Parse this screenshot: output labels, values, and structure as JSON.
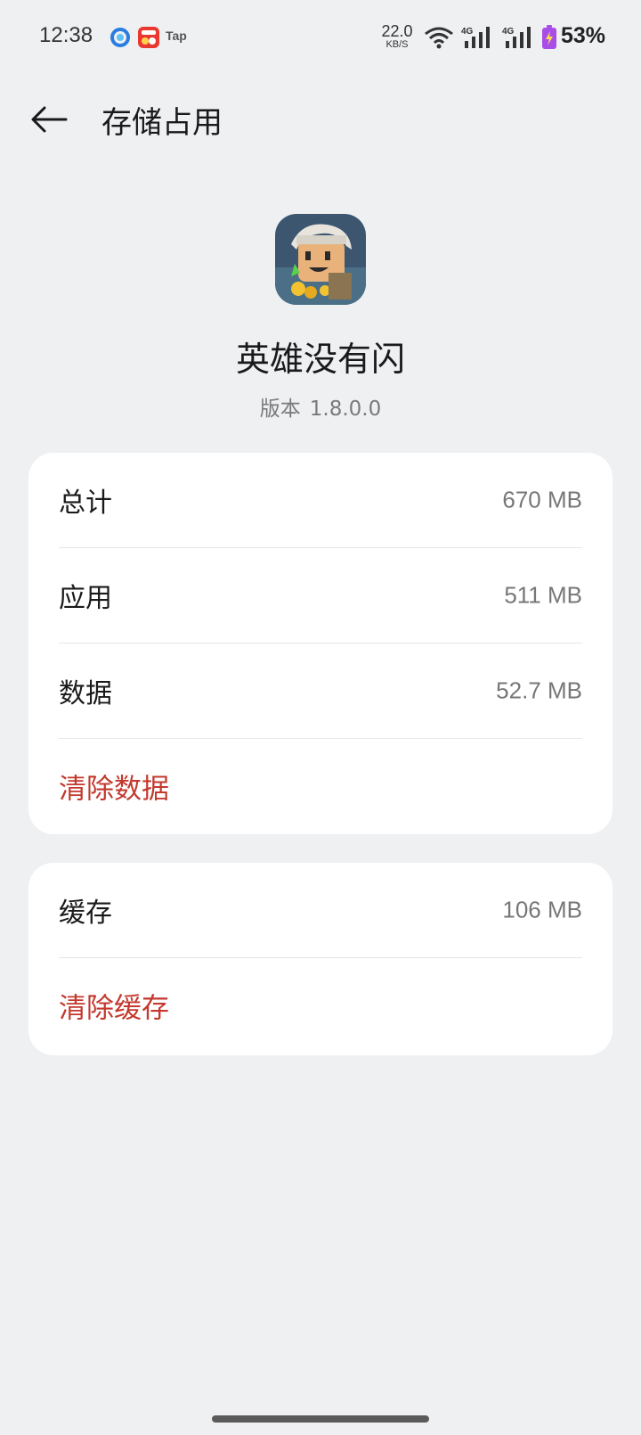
{
  "status_bar": {
    "time": "12:38",
    "app3_label": "Tap",
    "net_speed_value": "22.0",
    "net_speed_unit": "KB/S",
    "sig1_label": "4G",
    "sig2_label": "4G",
    "battery_percent": "53%",
    "icons": [
      "browser-icon",
      "game-app-icon",
      "tap-icon",
      "wifi-icon",
      "signal-icon",
      "signal-icon",
      "battery-charging-icon"
    ]
  },
  "header": {
    "title": "存储占用",
    "back_icon": "arrow-left-icon"
  },
  "app": {
    "name": "英雄没有闪",
    "version_label": "版本",
    "version": "1.8.0.0"
  },
  "storage": {
    "rows": [
      {
        "label": "总计",
        "value": "670 MB"
      },
      {
        "label": "应用",
        "value": "511 MB"
      },
      {
        "label": "数据",
        "value": "52.7 MB"
      }
    ],
    "clear_label": "清除数据"
  },
  "cache": {
    "label": "缓存",
    "value": "106 MB",
    "clear_label": "清除缓存"
  },
  "colors": {
    "background": "#eff0f2",
    "card": "#ffffff",
    "action_red": "#c4382d"
  }
}
